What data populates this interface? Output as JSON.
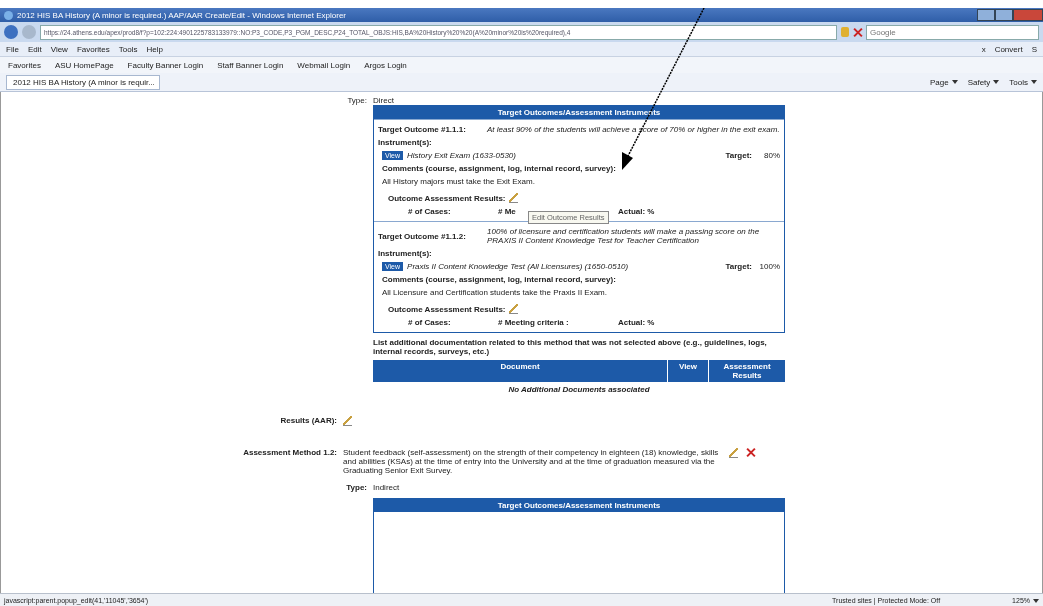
{
  "window": {
    "title": "2012 HIS BA History (A minor is required.) AAP/AAR Create/Edit - Windows Internet Explorer"
  },
  "address_bar": {
    "url": "https://24.athens.edu/apex/prod8/f?p=102:224:4901225783133979::NO:P3_CODE,P3_PGM_DESC,P24_TOTAL_OBJS:HIS,BA%20History%20%20(A%20minor%20is%20required),4",
    "search_placeholder": "Google"
  },
  "menu": [
    "File",
    "Edit",
    "View",
    "Favorites",
    "Tools",
    "Help"
  ],
  "toolbar_right": {
    "close": "x",
    "convert": "Convert",
    "cut": "S"
  },
  "favorites_bar": {
    "label": "Favorites",
    "links": [
      "ASU HomePage",
      "Faculty Banner Login",
      "Staff Banner Login",
      "Webmail Login",
      "Argos Login"
    ]
  },
  "tab": {
    "title": "2012 HIS BA History (A minor is requir..."
  },
  "command_bar": [
    "Page",
    "Safety",
    "Tools"
  ],
  "method_1": {
    "type_label": "Type:",
    "type": "Direct",
    "header": "Target Outcomes/Assessment Instruments",
    "outcomes": [
      {
        "label": "Target Outcome #1.1.1:",
        "text": "At least 90% of the students will achieve a score of 70% or higher in the exit exam.",
        "instruments_label": "Instrument(s):",
        "view": "View",
        "instrument": "History Exit Exam (1633-0530)",
        "target_label": "Target:",
        "target": "80%",
        "comments_label": "Comments (course, assignment, log, internal record, survey):",
        "comments": "All History majors must take the Exit Exam.",
        "results_label": "Outcome Assessment Results:",
        "cases": "# of Cases:",
        "meeting": "# Me",
        "actual": "Actual: %",
        "tooltip": "Edit Outcome Results"
      },
      {
        "label": "Target Outcome #1.1.2:",
        "text": "100% of licensure and certification students will make a passing score on the PRAXIS II Content Knowledge Test for Teacher Certification",
        "instruments_label": "Instrument(s):",
        "view": "View",
        "instrument": "Praxis II Content Knowledge Test (All Licensures) (1650-0510)",
        "target_label": "Target:",
        "target": "100%",
        "comments_label": "Comments (course, assignment, log, internal record, survey):",
        "comments": "All Licensure and Certification students take the Praxis II Exam.",
        "results_label": "Outcome Assessment Results:",
        "cases": "# of Cases:",
        "meeting": "# Meeting criteria :",
        "actual": "Actual: %"
      }
    ],
    "docs_note": "List additional documentation related to this method that was not selected above (e.g., guidelines, logs, internal records, surveys, etc.)",
    "docs_columns": [
      "Document",
      "View",
      "Assessment Results"
    ],
    "docs_empty": "No Additional Documents associated",
    "results_label": "Results (AAR):"
  },
  "method_2": {
    "label": "Assessment Method 1.2:",
    "text": "Student feedback (self-assessment) on the strength of their competency in eighteen (18) knowledge, skills and abilities (KSAs) at the time of entry into the University and at the time of graduation measured via the Graduating Senior Exit Survey.",
    "type_label": "Type:",
    "type": "Indirect",
    "header": "Target Outcomes/Assessment Instruments"
  },
  "status_bar": {
    "text": "javascript:parent.popup_edit(41,'11045','3654')",
    "zone": "Trusted sites | Protected Mode: Off",
    "zoom": "125%"
  }
}
